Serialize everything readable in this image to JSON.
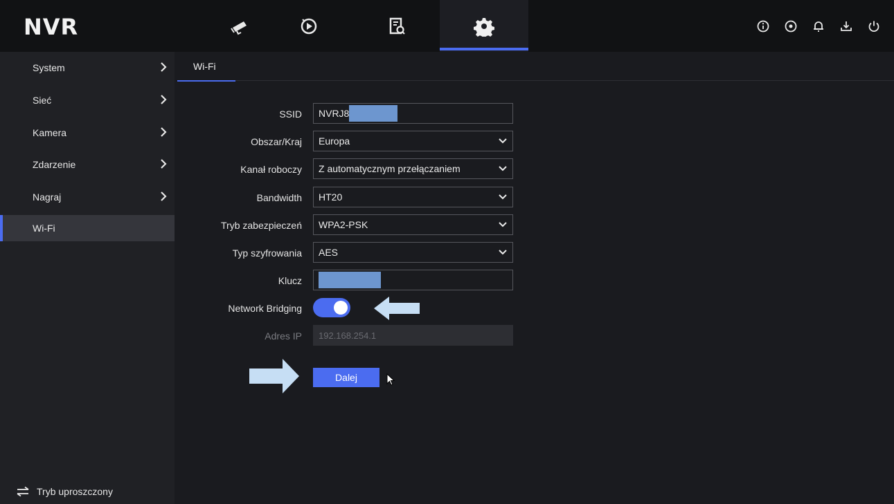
{
  "app": {
    "logo": "NVR"
  },
  "top_tabs": [
    {
      "icon": "camera-icon"
    },
    {
      "icon": "playback-icon"
    },
    {
      "icon": "search-file-icon"
    },
    {
      "icon": "gear-icon",
      "active": true
    }
  ],
  "top_right_icons": [
    "info-icon",
    "record-icon",
    "bell-icon",
    "download-icon",
    "power-icon"
  ],
  "sidebar": {
    "items": [
      {
        "label": "System"
      },
      {
        "label": "Sieć"
      },
      {
        "label": "Kamera"
      },
      {
        "label": "Zdarzenie"
      },
      {
        "label": "Nagraj"
      },
      {
        "label": "Wi-Fi",
        "active": true
      }
    ],
    "footer_label": "Tryb uproszczony"
  },
  "subtab": {
    "label": "Wi-Fi"
  },
  "form": {
    "ssid": {
      "label": "SSID",
      "value": "NVRJ8"
    },
    "region": {
      "label": "Obszar/Kraj",
      "value": "Europa"
    },
    "channel": {
      "label": "Kanał roboczy",
      "value": "Z automatycznym przełączaniem"
    },
    "bandwidth": {
      "label": "Bandwidth",
      "value": "HT20"
    },
    "security": {
      "label": "Tryb zabezpieczeń",
      "value": "WPA2-PSK"
    },
    "encryption": {
      "label": "Typ szyfrowania",
      "value": "AES"
    },
    "key": {
      "label": "Klucz",
      "value": ""
    },
    "bridging": {
      "label": "Network Bridging",
      "enabled": true
    },
    "ip": {
      "label": "Adres IP",
      "value": "192.168.254.1"
    },
    "next_label": "Dalej"
  },
  "colors": {
    "accent": "#4b6cf0",
    "annotation_arrow": "#c6def4",
    "mask": "#6d96cf"
  }
}
